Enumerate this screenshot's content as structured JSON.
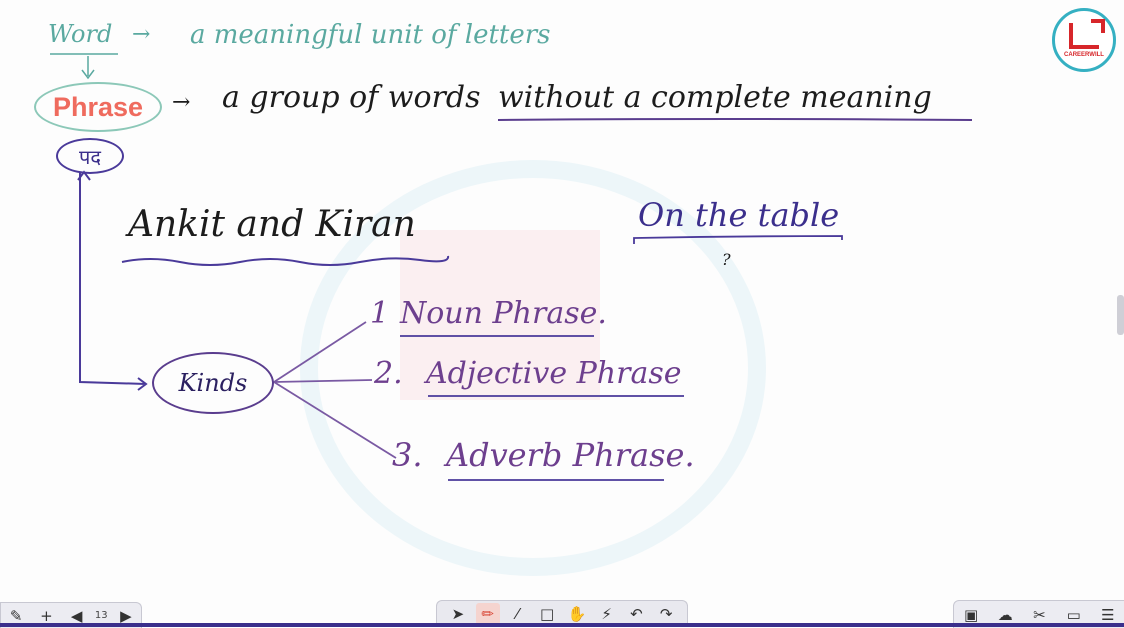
{
  "board": {
    "word_def": {
      "term": "Word",
      "arrow": "→",
      "definition": "a meaningful unit of letters"
    },
    "phrase_def": {
      "term": "Phrase",
      "arrow": "→",
      "definition_part1": "a group of words",
      "definition_part2": "without a complete meaning"
    },
    "hindi_term": "पद",
    "example1": "Ankit and Kiran",
    "example2": "On the table",
    "question_mark": "?",
    "kinds_label": "Kinds",
    "kinds": [
      {
        "number": "1",
        "label": "Noun Phrase."
      },
      {
        "number": "2.",
        "label": "Adjective Phrase"
      },
      {
        "number": "3.",
        "label": "Adverb Phrase."
      }
    ]
  },
  "logo": {
    "name": "CAREERWILL"
  },
  "toolbar": {
    "tools": [
      "pointer-icon",
      "pen-icon",
      "highlighter-icon",
      "shape-icon",
      "hand-icon",
      "laser-icon",
      "undo-icon",
      "redo-icon"
    ],
    "active": "pen-icon"
  },
  "page_nav": {
    "page_number": "13"
  },
  "colors": {
    "teal": "#5aa9a0",
    "purple": "#6d3f8e",
    "coral": "#ef6b5e",
    "accent": "#3b2f8c"
  }
}
